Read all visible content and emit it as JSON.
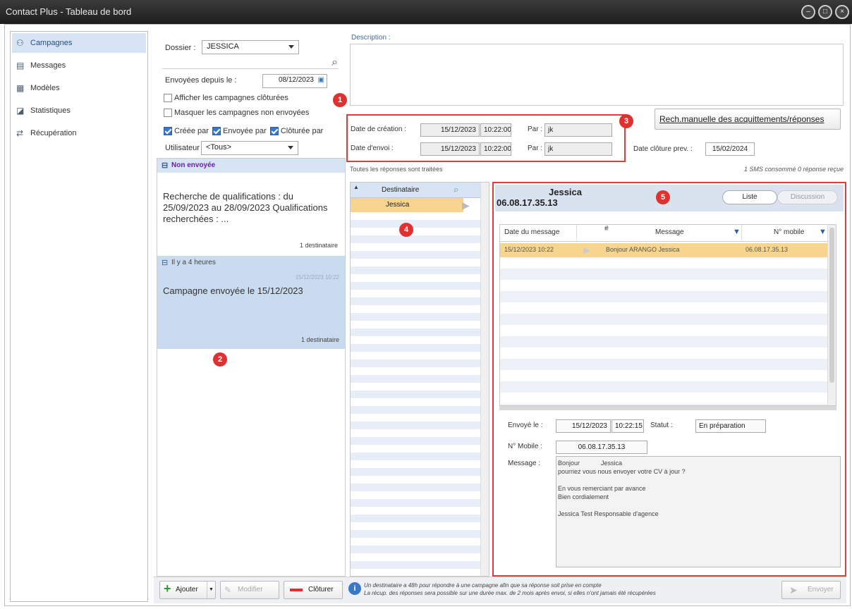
{
  "window": {
    "title": "Contact Plus - Tableau de bord",
    "controls": [
      "–",
      "□",
      "×"
    ]
  },
  "nav": {
    "items": [
      {
        "label": "Campagnes",
        "icon": "people-icon",
        "active": true
      },
      {
        "label": "Messages",
        "icon": "messages-icon",
        "active": false
      },
      {
        "label": "Modèles",
        "icon": "template-icon",
        "active": false
      },
      {
        "label": "Statistiques",
        "icon": "chart-icon",
        "active": false
      },
      {
        "label": "Récupération",
        "icon": "sync-arrows-icon",
        "active": false
      }
    ]
  },
  "filters": {
    "dossier_label": "Dossier :",
    "dossier_value": "JESSICA",
    "envoyees_label": "Envoyées depuis le :",
    "envoyees_value": "08/12/2023",
    "show_closed": "Afficher les campagnes clôturées",
    "hide_unsent": "Masquer les campagnes non envoyées",
    "creee_par": "Créée par",
    "envoyee_par": "Envoyée par",
    "cloturee_par": "Clôturée par",
    "utilisateur_label": "Utilisateur :",
    "utilisateur_value": "<Tous>"
  },
  "campaign_groups": [
    {
      "header": "Non envoyée",
      "item_text": "Recherche de qualifications : du 25/09/2023 au 28/09/2023 Qualifications recherchées : ...",
      "item_recipients": "1 destinataire"
    },
    {
      "header": "Il y a 4 heures",
      "item_date": "15/12/2023 10:22",
      "item_text": "Campagne envoyée le 15/12/2023",
      "item_recipients": "1 destinataire"
    }
  ],
  "details": {
    "description_label": "Description :",
    "creation_label": "Date de création :",
    "creation_date": "15/12/2023",
    "creation_time": "10:22:00",
    "par_label": "Par :",
    "creation_by": "jk",
    "envoi_label": "Date d'envoi :",
    "envoi_date": "15/12/2023",
    "envoi_time": "10:22:00",
    "envoi_by": "jk",
    "manual_search_button": "Rech.manuelle des acquittements/réponses",
    "cloture_label": "Date clôture prev. :",
    "cloture_value": "15/02/2024",
    "all_treated": "Toutes les réponses sont traitées",
    "sms_info": "1 SMS consommé 0 réponse reçue"
  },
  "recipients": {
    "header": "Destinataire",
    "rows": [
      "Jessica"
    ]
  },
  "message_panel": {
    "name": "Jessica",
    "number": "06.08.17.35.13",
    "tab_list": "Liste",
    "tab_discussion": "Discussion",
    "columns": [
      "Date du message",
      "#",
      "Message",
      "N° mobile"
    ],
    "rows": [
      {
        "date": "15/12/2023 10:22",
        "message": "Bonjour ARANGO Jessica",
        "mobile": "06.08.17.35.13"
      }
    ],
    "envoye_label": "Envoyé le :",
    "envoye_date": "15/12/2023",
    "envoye_time": "10:22:15",
    "statut_label": "Statut :",
    "statut_value": "En préparation",
    "mobile_label": "N° Mobile :",
    "mobile_value": "06.08.17.35.13",
    "message_label": "Message :",
    "message_body": "Bonjour            Jessica\npourriez vous nous envoyer votre CV à jour ?\n\nEn vous remerciant par avance\nBien cordialement\n\nJessica Test Responsable d'agence"
  },
  "badges": [
    "1",
    "2",
    "3",
    "4",
    "5"
  ],
  "footer": {
    "add": "Ajouter",
    "modify": "Modifier",
    "close": "Clôturer",
    "info_line1": "Un destinataire a 48h pour répondre à une campagne afin que sa réponse soit prise en compte",
    "info_line2": "La récup. des réponses sera possible sur une durée max. de 2 mois après envoi, si elles n'ont jamais été récupérées",
    "send": "Envoyer"
  },
  "colors": {
    "accent": "#d6e4f3",
    "badge_red": "#e03030",
    "highlight_row": "#f7d58e"
  }
}
